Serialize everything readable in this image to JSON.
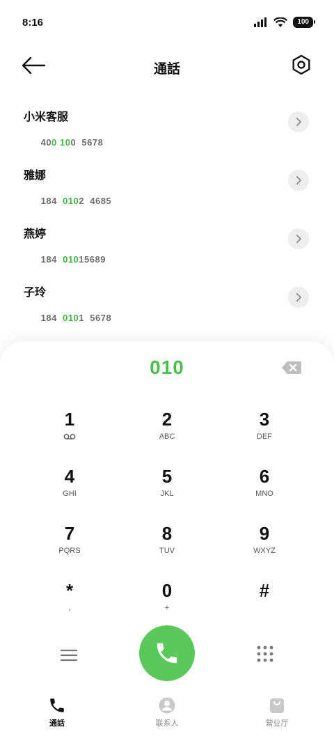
{
  "status_bar": {
    "time": "8:16",
    "battery": "100"
  },
  "header": {
    "title": "通話"
  },
  "contacts": [
    {
      "name": "小米客服",
      "number_parts": [
        {
          "t": "40",
          "hl": false
        },
        {
          "t": "0",
          "hl": true
        },
        {
          "t": " ",
          "hl": false
        },
        {
          "t": "10",
          "hl": true
        },
        {
          "t": "0  5678",
          "hl": false
        }
      ]
    },
    {
      "name": "雅娜",
      "number_parts": [
        {
          "t": "184  ",
          "hl": false
        },
        {
          "t": "010",
          "hl": true
        },
        {
          "t": "2  4685",
          "hl": false
        }
      ]
    },
    {
      "name": "燕婷",
      "number_parts": [
        {
          "t": "184  ",
          "hl": false
        },
        {
          "t": "010",
          "hl": true
        },
        {
          "t": "15689",
          "hl": false
        }
      ]
    },
    {
      "name": "子玲",
      "number_parts": [
        {
          "t": "184  ",
          "hl": false
        },
        {
          "t": "010",
          "hl": true
        },
        {
          "t": "1  5678",
          "hl": false
        }
      ]
    }
  ],
  "dialpad": {
    "dialed": "010",
    "keys": [
      {
        "digit": "1",
        "sub": "voicemail"
      },
      {
        "digit": "2",
        "sub": "ABC"
      },
      {
        "digit": "3",
        "sub": "DEF"
      },
      {
        "digit": "4",
        "sub": "GHI"
      },
      {
        "digit": "5",
        "sub": "JKL"
      },
      {
        "digit": "6",
        "sub": "MNO"
      },
      {
        "digit": "7",
        "sub": "PQRS"
      },
      {
        "digit": "8",
        "sub": "TUV"
      },
      {
        "digit": "9",
        "sub": "WXYZ"
      },
      {
        "digit": "*",
        "sub": ","
      },
      {
        "digit": "0",
        "sub": "+"
      },
      {
        "digit": "#",
        "sub": ""
      }
    ]
  },
  "bottom_nav": [
    {
      "label": "通話",
      "icon": "phone-icon",
      "active": true
    },
    {
      "label": "联系人",
      "icon": "contacts-icon",
      "active": false
    },
    {
      "label": "营业厅",
      "icon": "store-bag-icon",
      "active": false
    }
  ],
  "colors": {
    "accent_green": "#5ac85a",
    "highlight_green": "#43b443"
  }
}
